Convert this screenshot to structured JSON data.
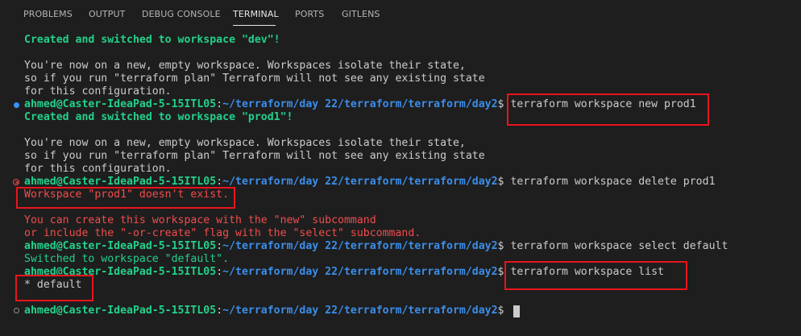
{
  "panel": {
    "tabs": [
      {
        "label": "PROBLEMS"
      },
      {
        "label": "OUTPUT"
      },
      {
        "label": "DEBUG CONSOLE"
      },
      {
        "label": "TERMINAL",
        "active": true
      },
      {
        "label": "PORTS"
      },
      {
        "label": "GITLENS"
      }
    ]
  },
  "terminal": {
    "prompt_user": "ahmed@Caster-IdeaPad-5-15ITL05",
    "prompt_sep": ":",
    "prompt_path": "~/terraform/day 22/terraform/terraform/day2",
    "prompt_symbol": "$ ",
    "output": {
      "created_dev": "Created and switched to workspace \"dev\"!",
      "created_prod1": "Created and switched to workspace \"prod1\"!",
      "info_1": "You're now on a new, empty workspace. Workspaces isolate their state,",
      "info_2": "so if you run \"terraform plan\" Terraform will not see any existing state",
      "info_3": "for this configuration.",
      "info_b1": "You're now on a new, empty workspace. Workspaces isolate their state,",
      "info_b2": "so if you run \"terraform plan\" Terraform will not see any existing state",
      "info_b3": "for this configuration.",
      "error_msg": "Workspace \"prod1\" doesn't exist.",
      "hint_1": "You can create this workspace with the \"new\" subcommand",
      "hint_2": "or include the \"-or-create\" flag with the \"select\" subcommand.",
      "switched_default": "Switched to workspace \"default\".",
      "list_default": "* default"
    },
    "commands": {
      "new_prod1": "terraform workspace new prod1",
      "delete_prod1": "terraform workspace delete prod1",
      "select_default": "terraform workspace select default",
      "list": "terraform workspace list"
    }
  },
  "colors": {
    "background": "#1e1e1e",
    "success_text": "#23d18b",
    "path_text": "#3b8eea",
    "error_text": "#f14c4c",
    "highlight_box": "#e8151b",
    "decoration_success": "#3794ff"
  }
}
